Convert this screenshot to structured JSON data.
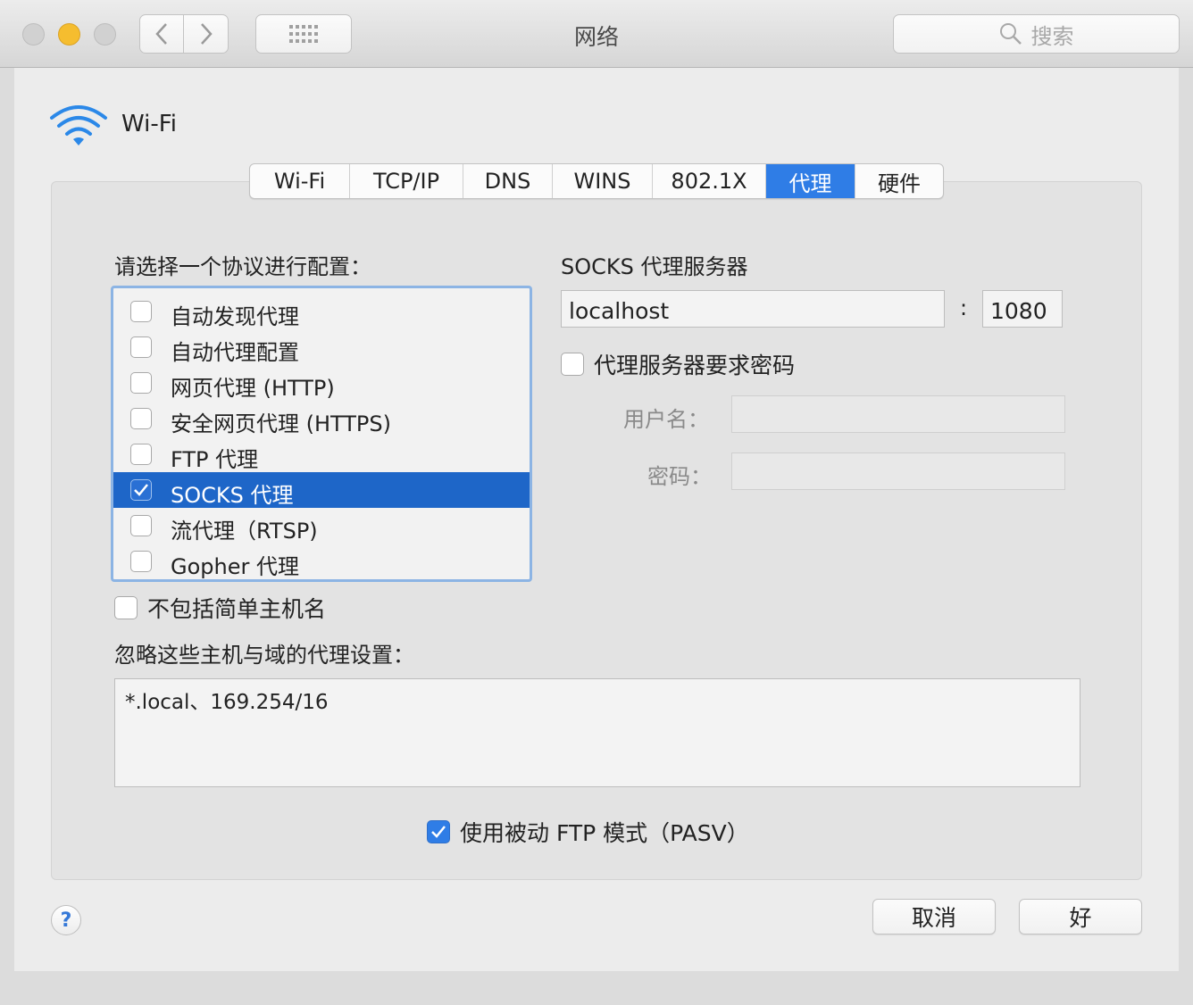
{
  "window": {
    "title": "网络",
    "search_placeholder": "搜索"
  },
  "interface": {
    "name": "Wi-Fi",
    "icon": "wifi-icon"
  },
  "tabs": [
    {
      "label": "Wi-Fi",
      "active": false
    },
    {
      "label": "TCP/IP",
      "active": false
    },
    {
      "label": "DNS",
      "active": false
    },
    {
      "label": "WINS",
      "active": false
    },
    {
      "label": "802.1X",
      "active": false
    },
    {
      "label": "代理",
      "active": true
    },
    {
      "label": "硬件",
      "active": false
    }
  ],
  "protocols": {
    "heading": "请选择一个协议进行配置：",
    "items": [
      {
        "label": "自动发现代理",
        "checked": false,
        "selected": false
      },
      {
        "label": "自动代理配置",
        "checked": false,
        "selected": false
      },
      {
        "label": "网页代理 (HTTP)",
        "checked": false,
        "selected": false
      },
      {
        "label": "安全网页代理 (HTTPS)",
        "checked": false,
        "selected": false
      },
      {
        "label": "FTP 代理",
        "checked": false,
        "selected": false
      },
      {
        "label": "SOCKS 代理",
        "checked": true,
        "selected": true
      },
      {
        "label": "流代理（RTSP)",
        "checked": false,
        "selected": false
      },
      {
        "label": "Gopher 代理",
        "checked": false,
        "selected": false
      }
    ]
  },
  "server": {
    "heading": "SOCKS 代理服务器",
    "host": "localhost",
    "separator": ":",
    "port": "1080",
    "password_required_label": "代理服务器要求密码",
    "password_required": false,
    "username_label": "用户名：",
    "username_value": "",
    "password_label": "密码：",
    "password_value": ""
  },
  "exclude_simple_hostnames": {
    "label": "不包括简单主机名",
    "checked": false
  },
  "bypass": {
    "heading": "忽略这些主机与域的代理设置：",
    "value": "*.local、169.254/16"
  },
  "passive_ftp": {
    "label": "使用被动 FTP 模式（PASV）",
    "checked": true
  },
  "buttons": {
    "cancel": "取消",
    "ok": "好",
    "help": "?"
  },
  "colors": {
    "accent": "#2f7de6",
    "selection": "#1e66c8",
    "focus_ring": "#8cb4e4"
  }
}
